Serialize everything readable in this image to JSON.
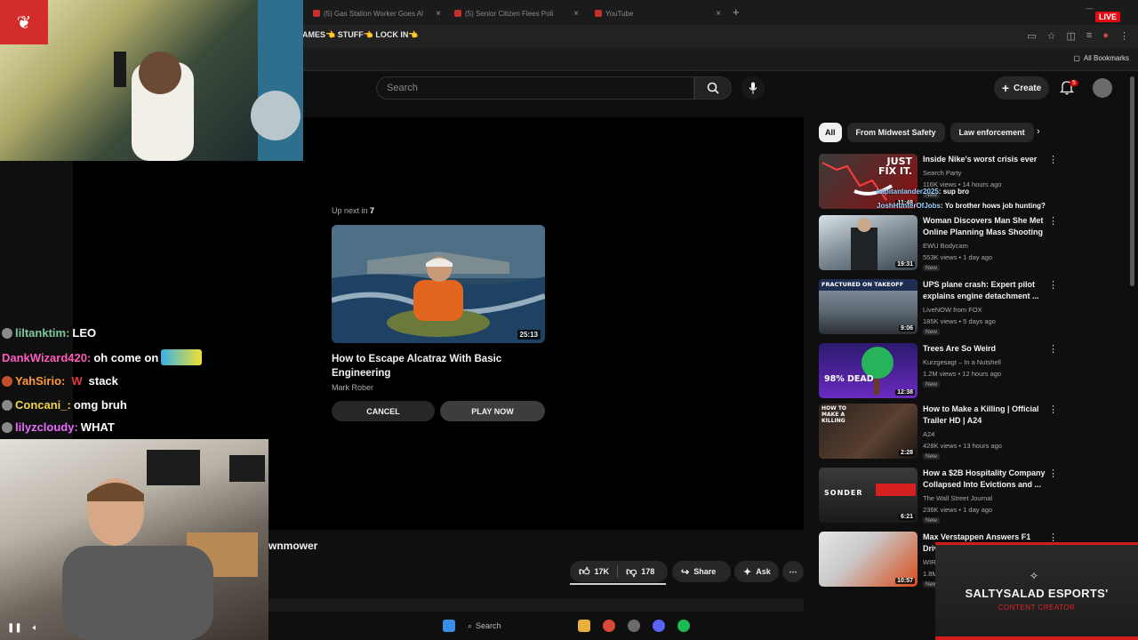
{
  "browser": {
    "tabs": [
      {
        "label": "(5) Gas Station Worker Goes Al"
      },
      {
        "label": "(5) Senior Citizen Flees Poli"
      },
      {
        "label": "YouTube"
      }
    ],
    "address_fragment": "AMES👈 STUFF👈 LOCK IN👈",
    "bookmarks_label": "All Bookmarks",
    "live_label": "LIVE"
  },
  "youtube": {
    "search_placeholder": "Search",
    "create_label": "Create",
    "notification_count": "5",
    "player": {
      "up_next_prefix": "Up next in",
      "up_next_seconds": "7",
      "up_next_title": "How to Escape Alcatraz With Basic Engineering",
      "up_next_channel": "Mark Rober",
      "up_next_duration": "25:13",
      "cancel_label": "CANCEL",
      "play_now_label": "PLAY NOW"
    },
    "video_title_fragment": "wnmower",
    "actions": {
      "likes": "17K",
      "dislikes": "178",
      "share_label": "Share",
      "ask_label": "Ask"
    },
    "chips": [
      "All",
      "From Midwest Safety",
      "Law enforcement"
    ],
    "recommendations": [
      {
        "title": "Inside Nike's worst crisis ever",
        "channel": "Search Party",
        "meta": "116K views • 14 hours ago",
        "badge": "New",
        "duration": "11:48",
        "thumb_text": "JUST FIX IT."
      },
      {
        "title": "Woman Discovers Man She Met Online Planning Mass Shooting",
        "channel": "EWU Bodycam",
        "meta": "553K views • 1 day ago",
        "badge": "New",
        "duration": "19:31",
        "thumb_text": ""
      },
      {
        "title": "UPS plane crash: Expert pilot explains engine detachment ...",
        "channel": "LiveNOW from FOX",
        "meta": "185K views • 5 days ago",
        "badge": "New",
        "duration": "9:06",
        "thumb_text": "FRACTURED ON TAKEOFF"
      },
      {
        "title": "Trees Are So Weird",
        "channel": "Kurzgesagt – In a Nutshell",
        "meta": "1.2M views • 12 hours ago",
        "badge": "New",
        "duration": "12:38",
        "thumb_text": "98% DEAD"
      },
      {
        "title": "How to Make a Killing | Official Trailer HD | A24",
        "channel": "A24",
        "meta": "428K views • 13 hours ago",
        "badge": "New",
        "duration": "2:28",
        "thumb_text": "HOW TO MAKE A KILLING"
      },
      {
        "title": "How a $2B Hospitality Company Collapsed Into Evictions and ...",
        "channel": "The Wall Street Journal",
        "meta": "236K views • 1 day ago",
        "badge": "New",
        "duration": "6:21",
        "thumb_text": "SONDER"
      },
      {
        "title": "Max Verstappen Answers F1 Driv",
        "channel": "WIR",
        "meta": "1.8M",
        "badge": "New",
        "duration": "10:57",
        "thumb_text": ""
      }
    ]
  },
  "stream": {
    "chat": [
      {
        "user": "liltanktim:",
        "message": "LEO",
        "color": "#7ec8a0"
      },
      {
        "user": "DankWizard420:",
        "message": "oh come on",
        "color": "#ff5bbf"
      },
      {
        "user": "YahSirio:",
        "message": "stack",
        "color": "#ff9a3c",
        "emote_text": "W"
      },
      {
        "user": "Concani_:",
        "message": "omg bruh",
        "color": "#f3d34a"
      },
      {
        "user": "lilyzcloudy:",
        "message": "WHAT",
        "color": "#e86cff"
      }
    ],
    "overlay_chat": [
      {
        "user": "kapitanlander2025",
        "message": ": sup bro"
      },
      {
        "user": "JoshHunterOfJobs",
        "message": ": Yo brother hows job hunting?"
      }
    ],
    "sponsor_name": "SALTYSALAD ESPORTS'",
    "sponsor_subtitle": "CONTENT CREATOR"
  },
  "taskbar": {
    "search_placeholder": "Search"
  },
  "colors": {
    "youtube_red": "#cc0000",
    "brand_red": "#d41b1b"
  }
}
